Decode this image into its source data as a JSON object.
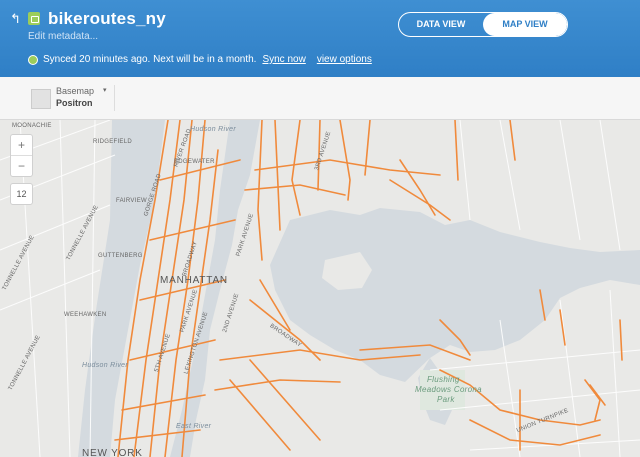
{
  "header": {
    "back_icon": "back-arrow-icon",
    "lock_icon": "lock-icon",
    "title": "bikeroutes_ny",
    "edit_metadata": "Edit metadata...",
    "sync_text": "Synced 20 minutes ago. Next will be in a month.",
    "sync_now": "Sync now",
    "view_options": "view options"
  },
  "view_toggle": {
    "data_view": "DATA VIEW",
    "map_view": "MAP VIEW",
    "active": "MAP VIEW"
  },
  "toolbar": {
    "basemap_label": "Basemap",
    "basemap_value": "Positron"
  },
  "map": {
    "zoom_in": "+",
    "zoom_out": "−",
    "zoom_level": "12",
    "labels": {
      "moonachie": "MOONACHIE",
      "ridgefield": "RIDGEFIELD",
      "edgewater": "EDGEWATER",
      "fairview": "FAIRVIEW",
      "guttenberg": "GUTTENBERG",
      "weehawken": "WEEHAWKEN",
      "hudson_river_1": "Hudson River",
      "hudson_river_2": "Hudson River",
      "river_road": "RIVER ROAD",
      "gorge_road": "GORGE ROAD",
      "tonnelle_1": "TONNELLE AVENUE",
      "tonnelle_2": "TONNELLE AVENUE",
      "tonnelle_3": "TONNELLE AVENUE",
      "broadway_1": "BROADWAY",
      "broadway_2": "BROADWAY",
      "third_ave": "3RD AVENUE",
      "park_ave": "PARK AVENUE",
      "second_ave": "2ND AVENUE",
      "lexington_ave": "LEXINGTON AVENUE",
      "fifth_ave": "5TH AVENUE",
      "park_ave_south": "PARK AVENUE",
      "manhattan": "MANHATTAN",
      "new_york": "NEW YORK",
      "east_river": "East River",
      "flushing_park_1": "Flushing",
      "flushing_park_2": "Meadows Corona",
      "flushing_park_3": "Park",
      "union_turnpike": "UNION TURNPIKE"
    },
    "route_color": "#f08a3c",
    "water_color": "#d4dadf",
    "land_color": "#e9e9e7"
  }
}
